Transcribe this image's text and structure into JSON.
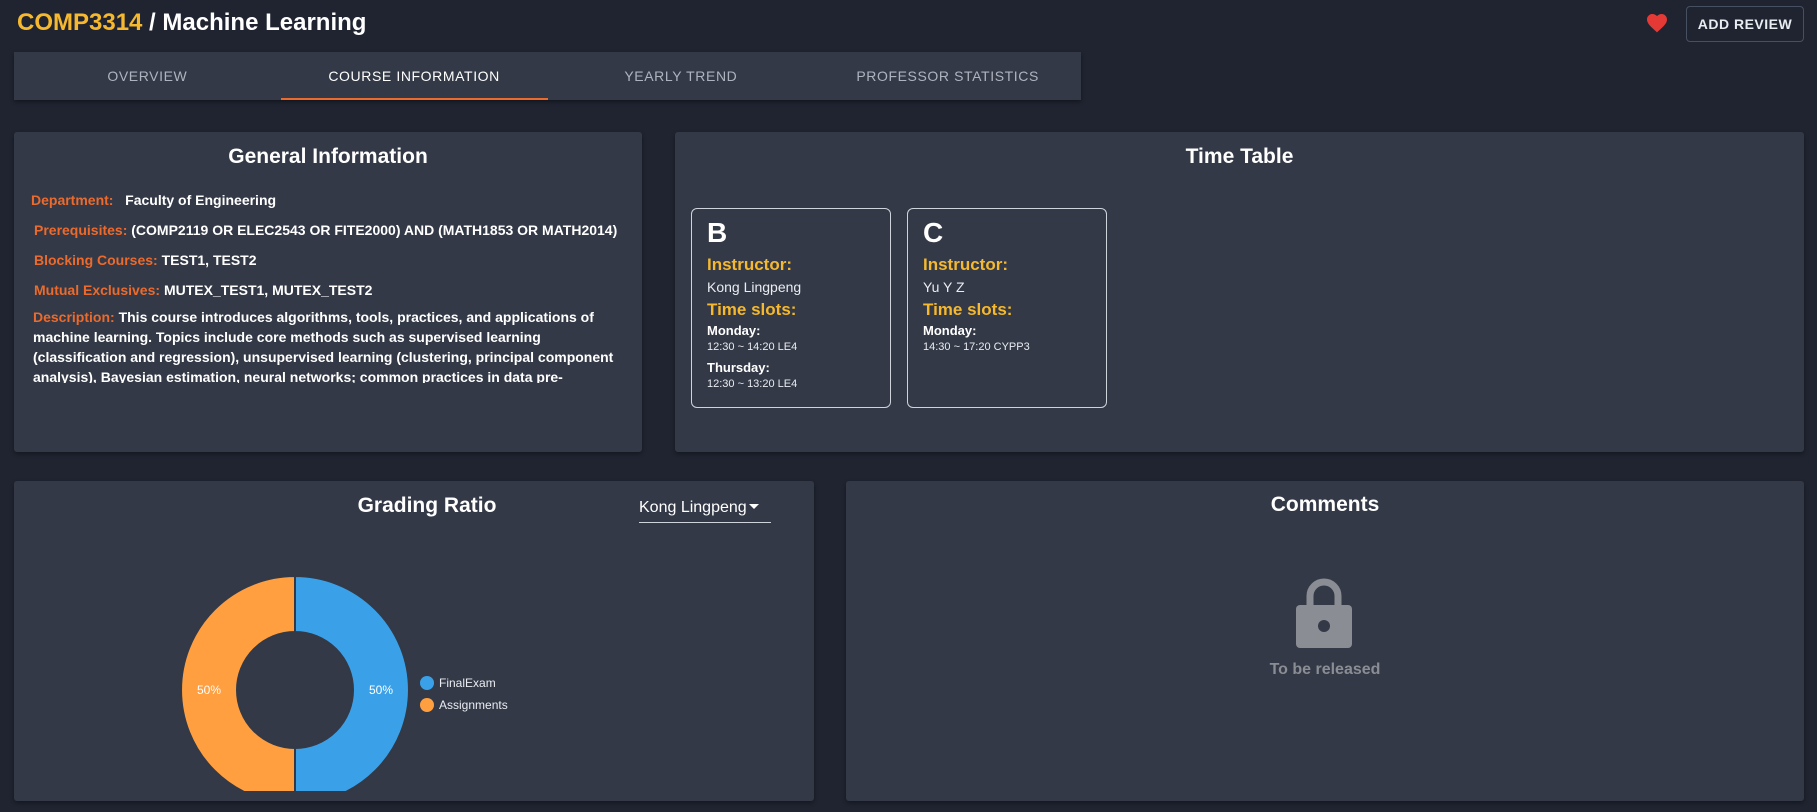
{
  "header": {
    "course_code": "COMP3314",
    "separator": " / ",
    "course_name": "Machine Learning",
    "add_review_label": "ADD REVIEW"
  },
  "tabs": [
    {
      "label": "OVERVIEW",
      "active": false
    },
    {
      "label": "COURSE INFORMATION",
      "active": true
    },
    {
      "label": "YEARLY TREND",
      "active": false
    },
    {
      "label": "PROFESSOR STATISTICS",
      "active": false
    }
  ],
  "general_info": {
    "title": "General Information",
    "department_label": "Department:",
    "department": "Faculty of Engineering",
    "prerequisites_label": "Prerequisites:",
    "prerequisites": "(COMP2119 OR ELEC2543 OR FITE2000) AND (MATH1853 OR MATH2014)",
    "blocking_label": "Blocking Courses:",
    "blocking": "TEST1, TEST2",
    "mutual_label": "Mutual Exclusives:",
    "mutual": "MUTEX_TEST1, MUTEX_TEST2",
    "description_label": "Description:",
    "description": "This course introduces algorithms, tools, practices, and applications of machine learning. Topics include core methods such as supervised learning (classification and regression), unsupervised learning (clustering, principal component analysis), Bayesian estimation, neural networks; common practices in data pre-processing, hyper-parameter"
  },
  "timetable": {
    "title": "Time Table",
    "instructor_label": "Instructor:",
    "timeslots_label": "Time slots:",
    "sections": [
      {
        "name": "B",
        "instructor": "Kong Lingpeng",
        "slots": [
          {
            "day": "Monday:",
            "time": "12:30 ~ 14:20 LE4"
          },
          {
            "day": "Thursday:",
            "time": "12:30 ~ 13:20 LE4"
          }
        ]
      },
      {
        "name": "C",
        "instructor": "Yu Y Z",
        "slots": [
          {
            "day": "Monday:",
            "time": "14:30 ~ 17:20 CYPP3"
          }
        ]
      }
    ]
  },
  "grading": {
    "title": "Grading Ratio",
    "selected_instructor": "Kong Lingpeng"
  },
  "chart_data": {
    "type": "pie",
    "donut": true,
    "categories": [
      "FinalExam",
      "Assignments"
    ],
    "values": [
      50,
      50
    ],
    "value_labels": [
      "50%",
      "50%"
    ],
    "colors": [
      "#3aa1e9",
      "#ff9f40"
    ],
    "legend_placement": "right"
  },
  "comments": {
    "title": "Comments",
    "status": "To be released"
  },
  "colors": {
    "background": "#1f2430",
    "card": "#333946",
    "accent_orange": "#ec6a2c",
    "accent_yellow": "#f5b82e",
    "heart": "#e53935"
  },
  "icons": {
    "favorite": "heart-icon",
    "dropdown": "caret-down-icon",
    "locked": "lock-icon"
  }
}
